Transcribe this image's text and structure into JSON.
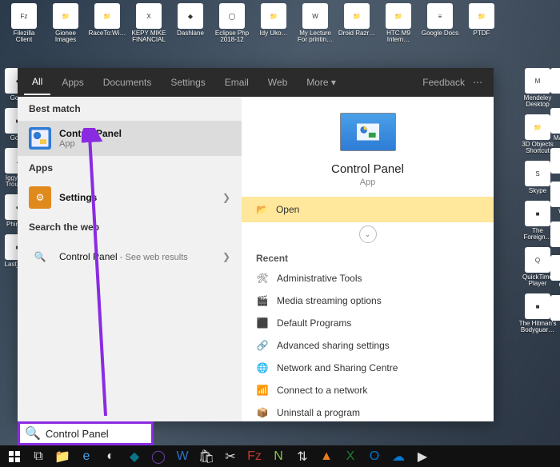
{
  "desktop_top": [
    {
      "label": "Filezilla Client",
      "glyph": "Fz",
      "cls": "bg-red"
    },
    {
      "label": "Gionee Images",
      "glyph": "📁",
      "cls": "bg-yellow"
    },
    {
      "label": "RaceTo:Wi…",
      "glyph": "📁",
      "cls": "bg-yellow"
    },
    {
      "label": "KEPY MIKE FINANCIAL…",
      "glyph": "X",
      "cls": "bg-green"
    },
    {
      "label": "Dashlane",
      "glyph": "◆",
      "cls": "bg-teal"
    },
    {
      "label": "Eclipse Php 2018-12",
      "glyph": "◯",
      "cls": "bg-dark"
    },
    {
      "label": "Idy Uko…",
      "glyph": "📁",
      "cls": "bg-yellow"
    },
    {
      "label": "My Lecture For printin…",
      "glyph": "W",
      "cls": "bg-blue"
    },
    {
      "label": "Droid Razr…",
      "glyph": "📁",
      "cls": "bg-yellow"
    },
    {
      "label": "HTC M9 Intern…",
      "glyph": "📁",
      "cls": "bg-yellow"
    },
    {
      "label": "Google Docs",
      "glyph": "≡",
      "cls": "bg-blue"
    },
    {
      "label": "PTDF",
      "glyph": "📁",
      "cls": "bg-yellow"
    }
  ],
  "desktop_left": [
    {
      "label": "Go…",
      "glyph": "◐"
    },
    {
      "label": "Go…",
      "glyph": "■"
    },
    {
      "label": "Iggy A… Troubl…",
      "glyph": "♪"
    },
    {
      "label": "Phink…",
      "glyph": "◐"
    },
    {
      "label": "Last_K…",
      "glyph": "■"
    }
  ],
  "desktop_right": [
    {
      "label": "Mendeley Desktop",
      "glyph": "M",
      "cls": "bg-red"
    },
    {
      "label": "3D Objects Shortcut",
      "glyph": "📁",
      "cls": "bg-yellow"
    },
    {
      "label": "Skype",
      "glyph": "S",
      "cls": "bg-blue"
    },
    {
      "label": "The Foreign…",
      "glyph": "■",
      "cls": "bg-dark"
    },
    {
      "label": "QuickTime Player",
      "glyph": "Q",
      "cls": "bg-blue"
    },
    {
      "label": "The Hitman's Bodyguar…",
      "glyph": "■",
      "cls": "bg-dark"
    }
  ],
  "desktop_right2": [
    {
      "label": "K",
      "glyph": "K"
    },
    {
      "label": "MATH.",
      "glyph": "m"
    },
    {
      "label": "",
      "glyph": ""
    },
    {
      "label": "Wa",
      "glyph": "■"
    },
    {
      "label": "",
      "glyph": ""
    },
    {
      "label": "Ga",
      "glyph": "📁"
    },
    {
      "label": "",
      "glyph": ""
    }
  ],
  "start": {
    "tabs": [
      "All",
      "Apps",
      "Documents",
      "Settings",
      "Email",
      "Web",
      "More ▾"
    ],
    "feedback": "Feedback",
    "best_match": "Best match",
    "best_result": {
      "title": "Control Panel",
      "subtitle": "App"
    },
    "apps_head": "Apps",
    "apps_result": {
      "title": "Settings"
    },
    "web_head": "Search the web",
    "web_result": {
      "title": "Control Panel",
      "subtitle": " - See web results"
    },
    "hero": {
      "name": "Control Panel",
      "type": "App"
    },
    "open": "Open",
    "recent_head": "Recent",
    "recent": [
      "Administrative Tools",
      "Media streaming options",
      "Default Programs",
      "Advanced sharing settings",
      "Network and Sharing Centre",
      "Connect to a network",
      "Uninstall a program"
    ]
  },
  "search": {
    "value": "Control Panel"
  },
  "colors": {
    "accent": "#8a2be2",
    "open_bg": "#ffe79b"
  }
}
